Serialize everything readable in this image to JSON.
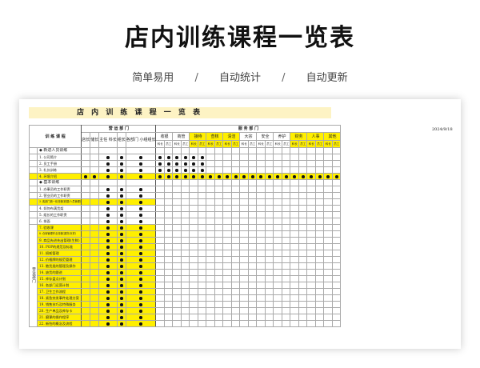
{
  "hero": {
    "title": "店内训练课程一览表",
    "tags": [
      "简单易用",
      "自动统计",
      "自动更新"
    ],
    "separator": "/"
  },
  "sheet": {
    "title": "店 内 训 练 课 程 一 览 表",
    "date": "2024/9/18",
    "header": {
      "course_col": "训 练 课 程",
      "op_group": "营 运 部 门",
      "svc_group": "服 务 部 门",
      "op_cols": [
        "店长",
        "储长",
        "主任 科长",
        "组长",
        "各部门 小组组长"
      ],
      "svc_depts": [
        "收银",
        "商管",
        "接待",
        "查核",
        "清洁",
        "大宗",
        "安全",
        "养护",
        "财务",
        "人事",
        "其他"
      ],
      "svc_sub": [
        "科长",
        "员工"
      ],
      "svc_highlight": [
        2,
        3,
        4,
        8,
        9,
        10
      ],
      "side_label": "营运部门"
    },
    "rows": [
      {
        "type": "section",
        "label": "◆ 新进人员训练"
      },
      {
        "type": "row",
        "label": "1. 公司简介",
        "dots": [
          0,
          0,
          1,
          1,
          1,
          1,
          1,
          1,
          1,
          1,
          1
        ],
        "hl": false
      },
      {
        "type": "row",
        "label": "2. 员工手册",
        "dots": [
          0,
          0,
          1,
          1,
          1,
          1,
          1,
          1,
          1,
          1,
          1
        ],
        "hl": false
      },
      {
        "type": "row",
        "label": "3. 礼仪训练",
        "dots": [
          0,
          0,
          1,
          1,
          1,
          1,
          1,
          1,
          1,
          1,
          1
        ],
        "hl": false
      },
      {
        "type": "row",
        "label": "4. 环境介绍",
        "dots": [
          1,
          1,
          1,
          1,
          1,
          1,
          1,
          1,
          1,
          1,
          1,
          1,
          1,
          1,
          1,
          1,
          1,
          1,
          1,
          1,
          1,
          1,
          1,
          1,
          1,
          1,
          1
        ],
        "hl": true,
        "full": true
      },
      {
        "type": "section",
        "label": "◆ 基本训练"
      },
      {
        "type": "row",
        "label": "1. 办事员的工作职责",
        "dots": [
          0,
          0,
          1,
          1,
          1
        ],
        "hl": false
      },
      {
        "type": "row",
        "label": "2. 营业员的工作职责",
        "dots": [
          0,
          0,
          1,
          1,
          1
        ],
        "hl": false
      },
      {
        "type": "row",
        "label": "3. 各部门统一化流程(收银/人员管理)",
        "dots": [
          0,
          0,
          1,
          1,
          1
        ],
        "hl": true,
        "small": true
      },
      {
        "type": "row",
        "label": "4. 如何布满货架",
        "dots": [
          0,
          0,
          1,
          1,
          1
        ],
        "hl": false
      },
      {
        "type": "row",
        "label": "5. 组长的工作职责",
        "dots": [
          0,
          0,
          1,
          1,
          1
        ],
        "hl": false
      },
      {
        "type": "row",
        "label": "6. 排面",
        "dots": [
          0,
          0,
          1,
          1,
          1
        ],
        "hl": false
      },
      {
        "type": "row",
        "label": "7. 验收课",
        "dots": [
          0,
          0,
          1,
          1,
          1
        ],
        "hl": true
      },
      {
        "type": "row",
        "label": "8. 仓库管理作业流程(退货/补货)",
        "dots": [
          0,
          0,
          1,
          1,
          1
        ],
        "hl": true,
        "small": true
      },
      {
        "type": "row",
        "label": "9. 商品先进先出管理(生鲜)",
        "dots": [
          0,
          0,
          1,
          1,
          1
        ],
        "hl": true
      },
      {
        "type": "row",
        "label": "10. POP的规范及标准",
        "dots": [
          0,
          0,
          1,
          1,
          1
        ],
        "hl": true
      },
      {
        "type": "row",
        "label": "11. 损耗管理",
        "dots": [
          0,
          0,
          1,
          1,
          1
        ],
        "hl": true
      },
      {
        "type": "row",
        "label": "12. 价格牌的规范管理",
        "dots": [
          0,
          0,
          1,
          1,
          1
        ],
        "hl": true
      },
      {
        "type": "row",
        "label": "13. 散货类的管理及操作",
        "dots": [
          0,
          0,
          1,
          1,
          1
        ],
        "hl": true
      },
      {
        "type": "row",
        "label": "14. 缺货的跟进",
        "dots": [
          0,
          0,
          1,
          1,
          1
        ],
        "hl": true
      },
      {
        "type": "row",
        "label": "15. 库存盘点计划",
        "dots": [
          0,
          0,
          1,
          1,
          1
        ],
        "hl": true
      },
      {
        "type": "row",
        "label": "16. 各部门运营计划",
        "dots": [
          0,
          0,
          1,
          1,
          1
        ],
        "hl": true
      },
      {
        "type": "row",
        "label": "17. 卫生工作流程",
        "dots": [
          0,
          0,
          1,
          1,
          1
        ],
        "hl": true
      },
      {
        "type": "row",
        "label": "18. 紧急突发事件处理方案",
        "dots": [
          0,
          0,
          1,
          1,
          1
        ],
        "hl": true
      },
      {
        "type": "row",
        "label": "19. 销售技巧及特殊服务",
        "dots": [
          0,
          0,
          1,
          1,
          1
        ],
        "hl": true
      },
      {
        "type": "row",
        "label": "20. 生产单品及库存卡",
        "dots": [
          0,
          0,
          1,
          1,
          1
        ],
        "hl": true
      },
      {
        "type": "row",
        "label": "21. 磨课的操作程序",
        "dots": [
          0,
          0,
          1,
          1,
          1
        ],
        "hl": true
      },
      {
        "type": "row",
        "label": "22. 新怡的概念及流程",
        "dots": [
          0,
          0,
          1,
          1,
          1
        ],
        "hl": true
      }
    ]
  }
}
